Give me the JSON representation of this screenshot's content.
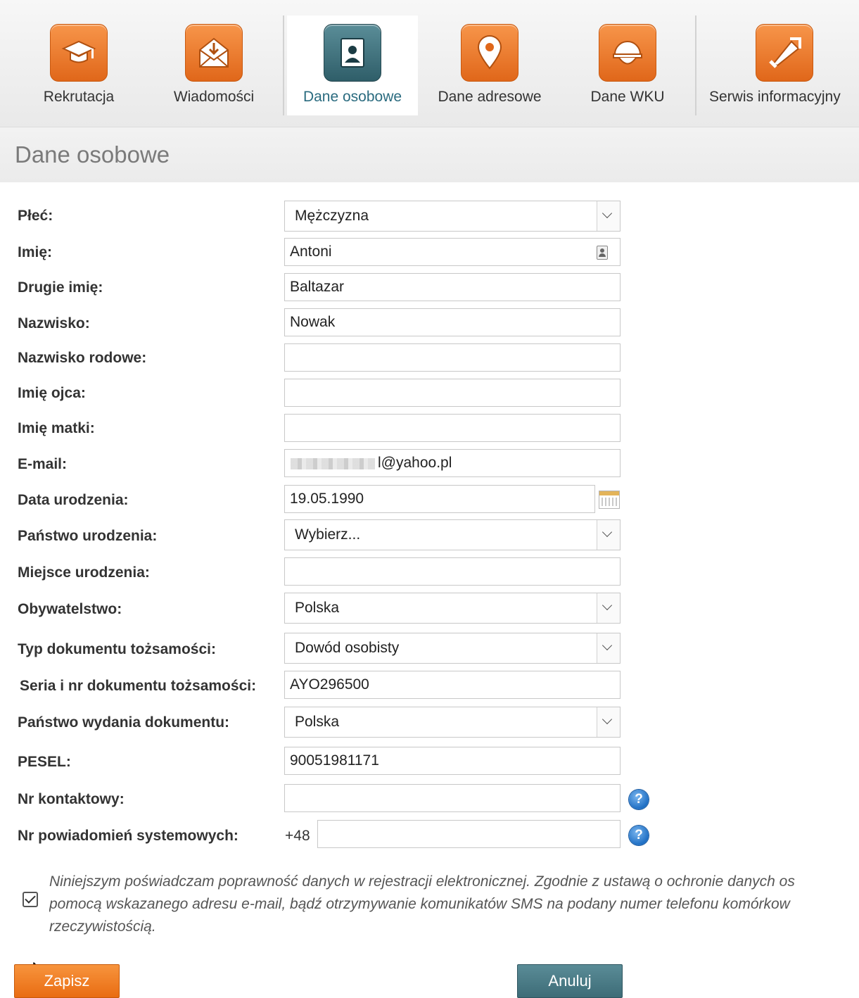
{
  "nav": {
    "items": [
      {
        "label": "Rekrutacja",
        "icon": "graduation-cap-icon"
      },
      {
        "label": "Wiadomości",
        "icon": "envelope-download-icon"
      },
      {
        "label": "Dane osobowe",
        "icon": "id-card-icon"
      },
      {
        "label": "Dane adresowe",
        "icon": "map-pin-icon"
      },
      {
        "label": "Dane WKU",
        "icon": "helmet-icon"
      },
      {
        "label": "Serwis informacyjny",
        "icon": "megaphone-icon"
      }
    ],
    "active": "Dane osobowe"
  },
  "page": {
    "title": "Dane osobowe"
  },
  "form": {
    "plec": {
      "label": "Płeć:",
      "value": "Mężczyzna"
    },
    "imie": {
      "label": "Imię:",
      "value": "Antoni"
    },
    "drugie_imie": {
      "label": "Drugie imię:",
      "value": "Baltazar"
    },
    "nazwisko": {
      "label": "Nazwisko:",
      "value": "Nowak"
    },
    "nazwisko_rodowe": {
      "label": "Nazwisko rodowe:",
      "value": ""
    },
    "imie_ojca": {
      "label": "Imię ojca:",
      "value": ""
    },
    "imie_matki": {
      "label": "Imię matki:",
      "value": ""
    },
    "email": {
      "label": "E-mail:",
      "value": "l@yahoo.pl"
    },
    "data_urodzenia": {
      "label": "Data urodzenia:",
      "value": "19.05.1990"
    },
    "panstwo_urodzenia": {
      "label": "Państwo urodzenia:",
      "value": "Wybierz..."
    },
    "miejsce_urodzenia": {
      "label": "Miejsce urodzenia:",
      "value": ""
    },
    "obywatelstwo": {
      "label": "Obywatelstwo:",
      "value": "Polska"
    },
    "typ_dokumentu": {
      "label": "Typ dokumentu tożsamości:",
      "value": "Dowód osobisty"
    },
    "seria_nr": {
      "label": "Seria i nr dokumentu tożsamości:",
      "value": "AYO296500"
    },
    "panstwo_wydania": {
      "label": "Państwo wydania dokumentu:",
      "value": "Polska"
    },
    "pesel": {
      "label": "PESEL:",
      "value": "90051981171"
    },
    "nr_kontaktowy": {
      "label": "Nr kontaktowy:",
      "value": ""
    },
    "nr_powiadomien": {
      "label": "Nr powiadomień systemowych:",
      "prefix": "+48",
      "value": ""
    }
  },
  "consent": {
    "checked": true,
    "line1": "Niniejszym poświadczam poprawność danych w rejestracji elektronicznej. Zgodnie z ustawą o ochronie danych os",
    "line2": "pomocą wskazanego adresu e-mail, bądź otrzymywanie komunikatów SMS na podany numer telefonu komórkow",
    "line3": "rzeczywistością."
  },
  "buttons": {
    "save": "Zapisz",
    "cancel": "Anuluj"
  },
  "colors": {
    "accent_orange": "#e96c12",
    "accent_teal": "#3d6c77"
  }
}
